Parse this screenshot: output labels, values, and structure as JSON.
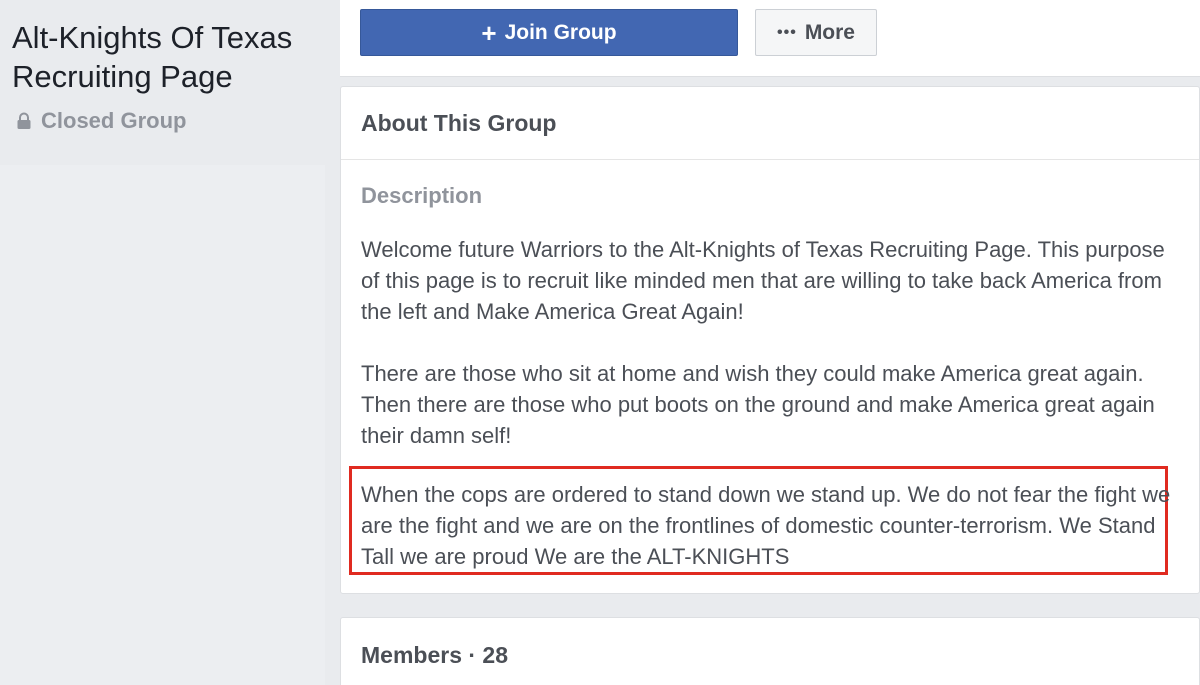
{
  "group": {
    "title": "Alt-Knights Of Texas Recruiting Page",
    "privacy": "Closed Group"
  },
  "actions": {
    "join_label": "Join Group",
    "more_label": "More"
  },
  "about": {
    "heading": "About This Group",
    "description_label": "Description",
    "paragraphs": [
      "Welcome future Warriors to the Alt-Knights of Texas Recruiting Page. This purpose of this page is to recruit like minded men that are willing to take back America from the left and Make America Great Again!",
      "There are those who sit at home and wish they could make America great again. Then there are those who put boots on the ground and make America great again their damn self!",
      "When the cops are ordered to stand down we stand up. We do not fear the fight we are the fight and we are on the frontlines of domestic counter-terrorism. We Stand Tall we are proud We are the ALT-KNIGHTS"
    ],
    "highlight_color": "#e02a20"
  },
  "members": {
    "heading": "Members · 28"
  },
  "colors": {
    "primary_button": "#4267b2",
    "background": "#e9ebee"
  },
  "icons": {
    "privacy": "lock-icon",
    "join": "plus-icon",
    "more": "ellipsis-icon"
  }
}
